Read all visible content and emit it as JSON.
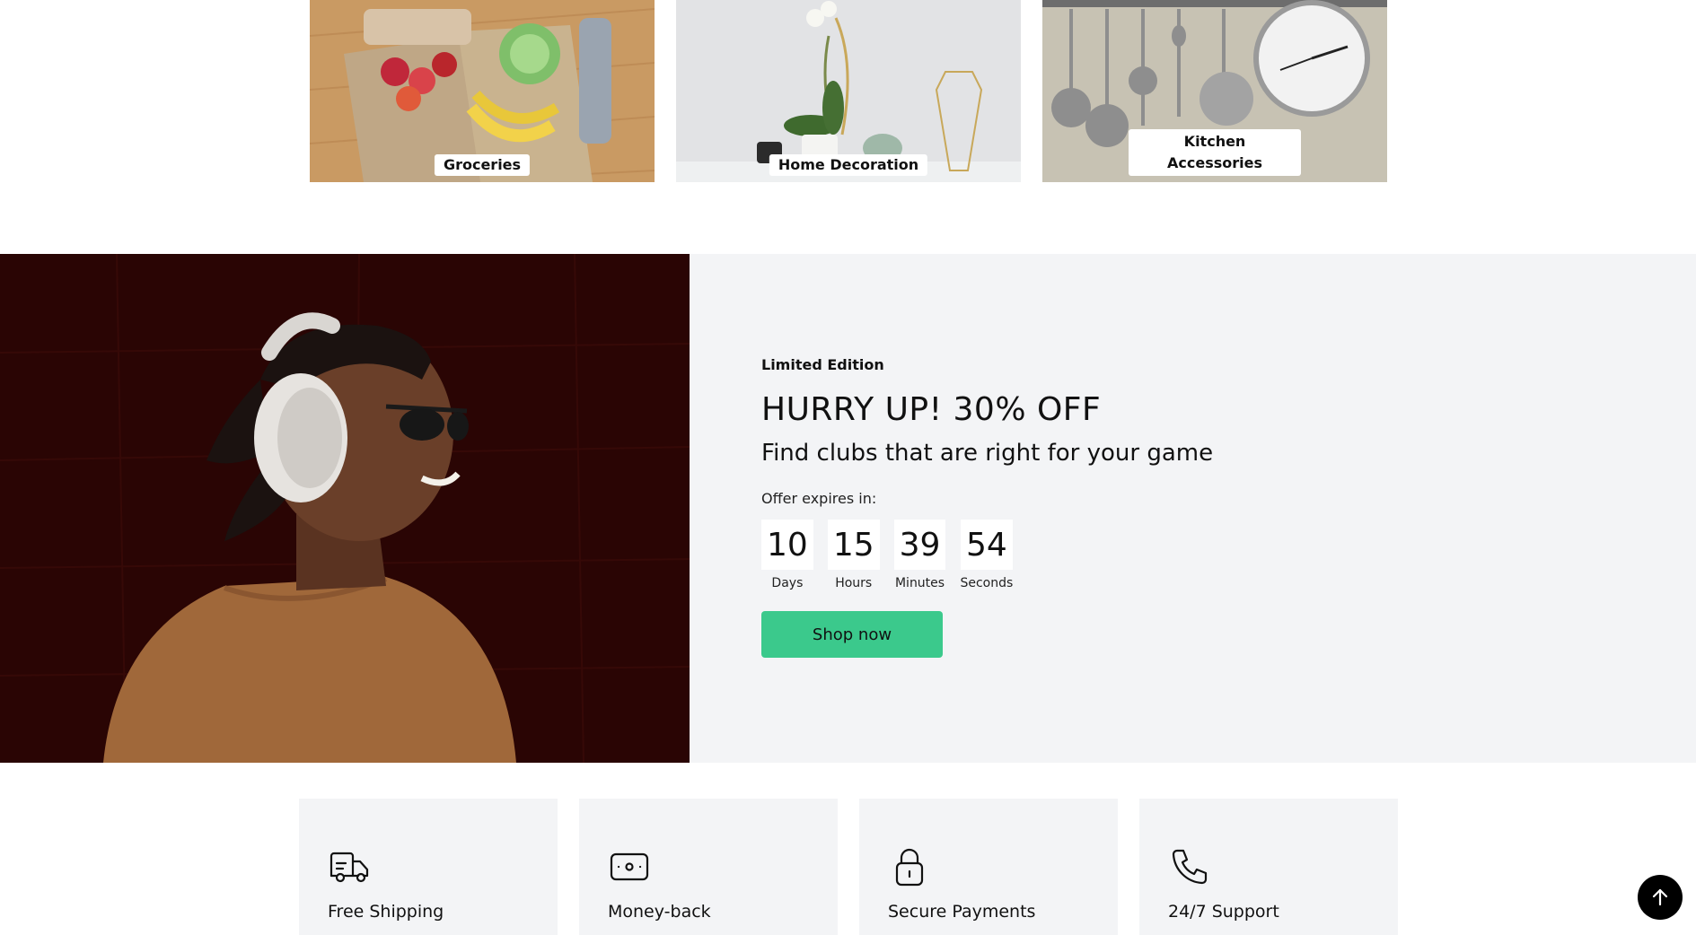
{
  "categories": [
    {
      "label": "Groceries",
      "icon": "groceries-photo"
    },
    {
      "label": "Home Decoration",
      "icon": "home-decoration-photo"
    },
    {
      "label": "Kitchen Accessories",
      "icon": "kitchen-accessories-photo"
    }
  ],
  "promo": {
    "eyebrow": "Limited Edition",
    "headline": "HURRY UP! 30% OFF",
    "subline": "Find clubs that are right for your game",
    "expires_label": "Offer expires in:",
    "countdown": [
      {
        "value": "10",
        "label": "Days"
      },
      {
        "value": "15",
        "label": "Hours"
      },
      {
        "value": "39",
        "label": "Minutes"
      },
      {
        "value": "54",
        "label": "Seconds"
      }
    ],
    "cta_label": "Shop now",
    "cta_color": "#3bc98c",
    "panel_color": "#f3f4f6",
    "image": "man-with-headphones-photo"
  },
  "features": [
    {
      "title": "Free Shipping",
      "icon": "truck-icon"
    },
    {
      "title": "Money-back",
      "icon": "cash-icon"
    },
    {
      "title": "Secure Payments",
      "icon": "lock-icon"
    },
    {
      "title": "24/7 Support",
      "icon": "phone-icon"
    }
  ],
  "back_to_top": {
    "icon": "arrow-up-icon"
  }
}
